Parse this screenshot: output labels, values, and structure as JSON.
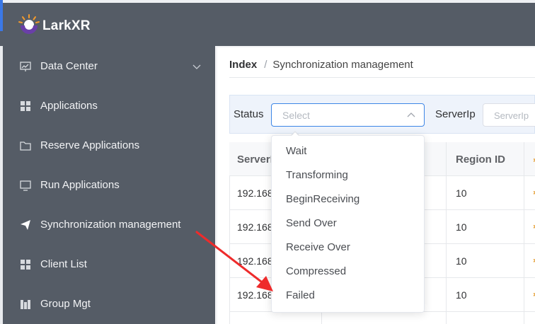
{
  "app": {
    "brand": "LarkXR",
    "accent_color": "#3d86e6",
    "sidebar_color": "#555c66"
  },
  "sidebar": {
    "items": [
      {
        "label": "Data Center",
        "icon": "monitor-chart-icon",
        "has_submenu": true
      },
      {
        "label": "Applications",
        "icon": "grid-icon"
      },
      {
        "label": "Reserve Applications",
        "icon": "folder-icon"
      },
      {
        "label": "Run Applications",
        "icon": "monitor-icon"
      },
      {
        "label": "Synchronization management",
        "icon": "paper-plane-icon",
        "active": true
      },
      {
        "label": "Client List",
        "icon": "grid-icon"
      },
      {
        "label": "Group Mgt",
        "icon": "bar-icon"
      }
    ]
  },
  "breadcrumb": {
    "root": "Index",
    "separator": "/",
    "current": "Synchronization management"
  },
  "filters": {
    "status_label": "Status",
    "status_placeholder": "Select",
    "serverip_label": "ServerIp",
    "serverip_placeholder": "ServerIp"
  },
  "status_dropdown": {
    "open": true,
    "options": [
      "Wait",
      "Transforming",
      "BeginReceiving",
      "Send Over",
      "Receive Over",
      "Compressed",
      "Failed"
    ]
  },
  "table": {
    "headers": [
      "ServerIp",
      "Region ID"
    ],
    "rows": [
      {
        "serverip": "192.168",
        "region_id": "10"
      },
      {
        "serverip": "192.168",
        "region_id": "10"
      },
      {
        "serverip": "192.168",
        "region_id": "10"
      },
      {
        "serverip": "192.168",
        "region_id": "10"
      }
    ]
  },
  "annotation": {
    "color": "#ee2b2b",
    "points_to": "Failed"
  }
}
